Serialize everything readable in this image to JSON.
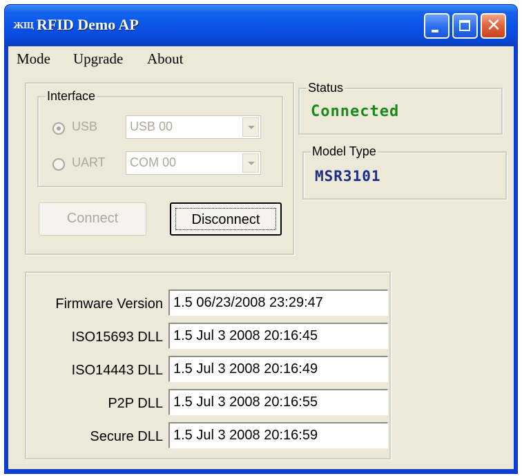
{
  "window": {
    "icon_text": "ЖЩ",
    "title": "RFID Demo AP"
  },
  "menu": {
    "mode": "Mode",
    "upgrade": "Upgrade",
    "about": "About"
  },
  "interface": {
    "legend": "Interface",
    "usb_label": "USB",
    "usb_value": "USB 00",
    "uart_label": "UART",
    "uart_value": "COM 00",
    "selected": "USB"
  },
  "buttons": {
    "connect": "Connect",
    "disconnect": "Disconnect"
  },
  "status": {
    "legend": "Status",
    "value": "Connected",
    "color": "#1a8a1a"
  },
  "model": {
    "legend": "Model Type",
    "value": "MSR3101",
    "color": "#1b2d8a"
  },
  "versions": [
    {
      "label": "Firmware Version",
      "value": "1.5 06/23/2008 23:29:47"
    },
    {
      "label": "ISO15693 DLL",
      "value": "1.5  Jul  3 2008 20:16:45"
    },
    {
      "label": "ISO14443 DLL",
      "value": "1.5  Jul  3 2008 20:16:49"
    },
    {
      "label": "P2P DLL",
      "value": "1.5  Jul  3 2008 20:16:55"
    },
    {
      "label": "Secure DLL",
      "value": "1.5  Jul  3 2008 20:16:59"
    }
  ],
  "colors": {
    "titlebar": "#0a54e8",
    "client_bg": "#ece9d8",
    "disabled_text": "#aca899"
  }
}
